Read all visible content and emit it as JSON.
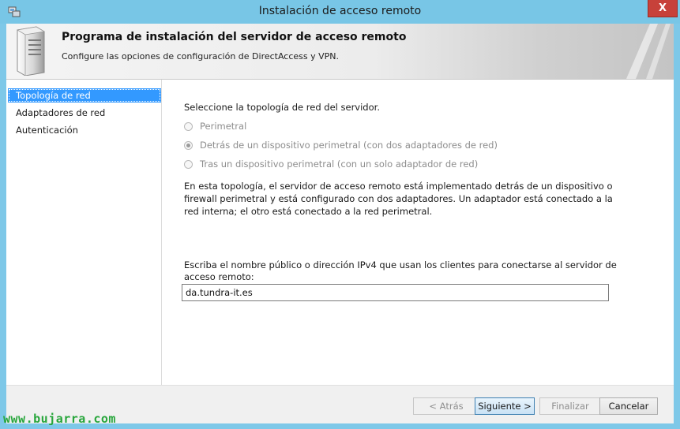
{
  "window": {
    "title": "Instalación de acceso remoto",
    "close_label": "X"
  },
  "header": {
    "title": "Programa de instalación del servidor de acceso remoto",
    "subtitle": "Configure las opciones de configuración de DirectAccess y VPN."
  },
  "nav": {
    "items": [
      {
        "label": "Topología de red",
        "selected": true
      },
      {
        "label": "Adaptadores de red",
        "selected": false
      },
      {
        "label": "Autenticación",
        "selected": false
      }
    ]
  },
  "content": {
    "heading": "Seleccione la topología de red del servidor.",
    "options": [
      {
        "label": "Perimetral",
        "checked": false
      },
      {
        "label": "Detrás de un dispositivo perimetral (con dos adaptadores de red)",
        "checked": true
      },
      {
        "label": "Tras un dispositivo perimetral (con un solo adaptador de red)",
        "checked": false
      }
    ],
    "description": "En esta topología, el servidor de acceso remoto está implementado detrás de un dispositivo o firewall perimetral y está configurado con dos adaptadores. Un adaptador está conectado a la red interna; el otro está conectado a la red perimetral.",
    "host_prompt": "Escriba el nombre público o dirección IPv4 que usan los clientes para conectarse al servidor de acceso remoto:",
    "host_value": "da.tundra-it.es"
  },
  "footer": {
    "back_label": "< Atrás",
    "next_label": "Siguiente >",
    "finish_label": "Finalizar",
    "cancel_label": "Cancelar"
  },
  "watermark": "www.bujarra.com",
  "colors": {
    "titlebar": "#78c6e6",
    "selection": "#3399ff",
    "close": "#c7413a",
    "watermark": "#28a63c"
  }
}
